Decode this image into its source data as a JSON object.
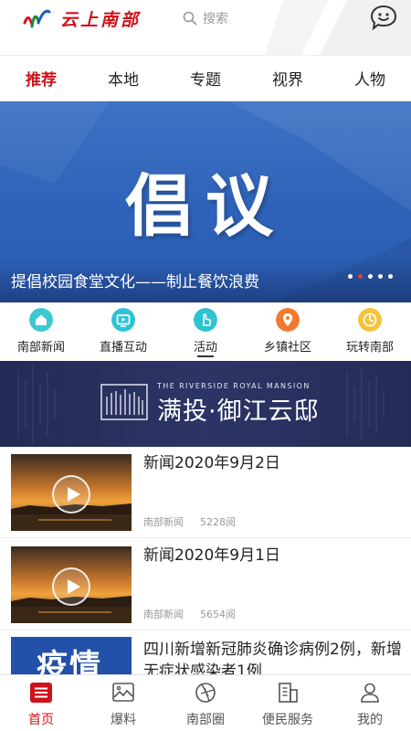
{
  "header": {
    "logo_text": "云上南部",
    "search_placeholder": "搜索"
  },
  "tabs": [
    {
      "label": "推荐",
      "active": true
    },
    {
      "label": "本地",
      "active": false
    },
    {
      "label": "专题",
      "active": false
    },
    {
      "label": "视界",
      "active": false
    },
    {
      "label": "人物",
      "active": false
    }
  ],
  "banner": {
    "title": "倡议",
    "caption": "提倡校园食堂文化——制止餐饮浪费",
    "slide_count": 5,
    "active_slide": 2
  },
  "quick_nav": [
    {
      "label": "南部新闻",
      "icon": "home-icon",
      "color": "#3cc8d0"
    },
    {
      "label": "直播互动",
      "icon": "tv-icon",
      "color": "#2ec2d6"
    },
    {
      "label": "活动",
      "icon": "hand-pointer-icon",
      "color": "#2fc3cf"
    },
    {
      "label": "乡镇社区",
      "icon": "location-badge-icon",
      "color": "#f07a2e"
    },
    {
      "label": "玩转南部",
      "icon": "compass-icon",
      "color": "#f6c23a"
    }
  ],
  "ad": {
    "subtitle": "THE RIVERSIDE ROYAL MANSION",
    "title": "满投·御江云邸"
  },
  "news": [
    {
      "title": "新闻2020年9月2日",
      "source": "南部新闻",
      "views": "5228阅"
    },
    {
      "title": "新闻2020年9月1日",
      "source": "南部新闻",
      "views": "5654阅"
    }
  ],
  "news_partial": {
    "thumb_text": "疫情",
    "title": "四川新增新冠肺炎确诊病例2例，新增无症状感染者1例"
  },
  "bottom_nav": [
    {
      "label": "首页",
      "icon": "home-menu-icon",
      "active": true
    },
    {
      "label": "爆料",
      "icon": "image-icon",
      "active": false
    },
    {
      "label": "南部圈",
      "icon": "aperture-icon",
      "active": false
    },
    {
      "label": "便民服务",
      "icon": "building-icon",
      "active": false
    },
    {
      "label": "我的",
      "icon": "user-icon",
      "active": false
    }
  ],
  "colors": {
    "accent": "#d0121b",
    "banner_blue": "#2d62b8",
    "ad_navy": "#2d3566"
  }
}
